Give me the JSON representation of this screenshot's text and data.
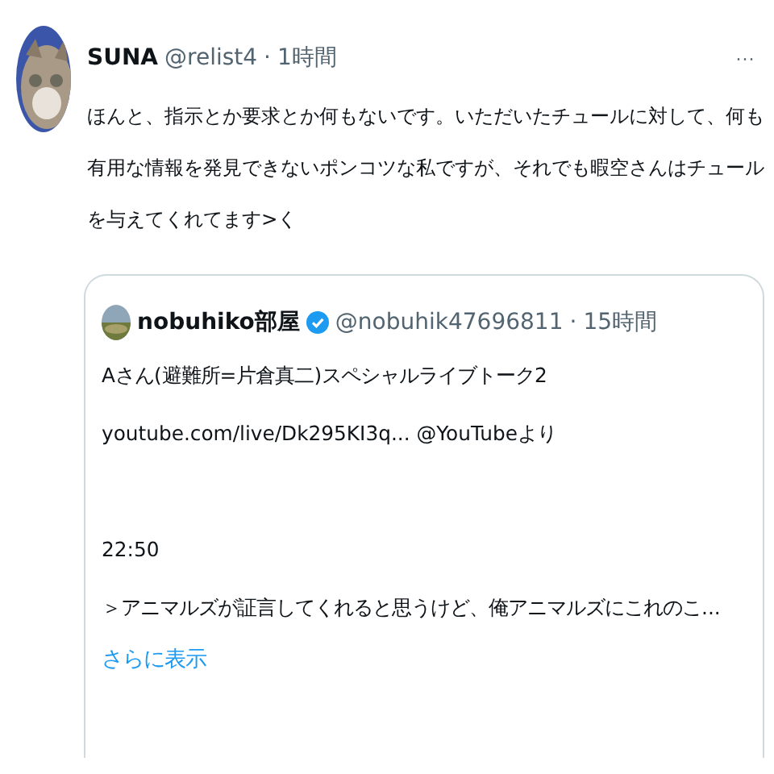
{
  "tweet": {
    "name": "SUNA",
    "handle": "@relist4",
    "separator": "·",
    "time": "1時間",
    "more": "···",
    "body": "ほんと、指示とか要求とか何もないです。いただいたチュールに対して、何も有用な情報を発見できないポンコツな私ですが、それでも暇空さんはチュールを与えてくれてます>く"
  },
  "quote": {
    "name": "nobuhiko部屋",
    "verified": true,
    "handle": "@nobuhik47696811",
    "separator": "·",
    "time": "15時間",
    "paragraphs": [
      [
        "Aさん(避難所=片倉真二)スペシャルライブトーク2",
        "youtube.com/live/Dk295KI3q... @YouTubeより"
      ],
      [
        "22:50",
        "＞アニマルズが証言してくれると思うけど、俺アニマルズにこれのこ..."
      ]
    ],
    "show_more": "さらに表示"
  }
}
